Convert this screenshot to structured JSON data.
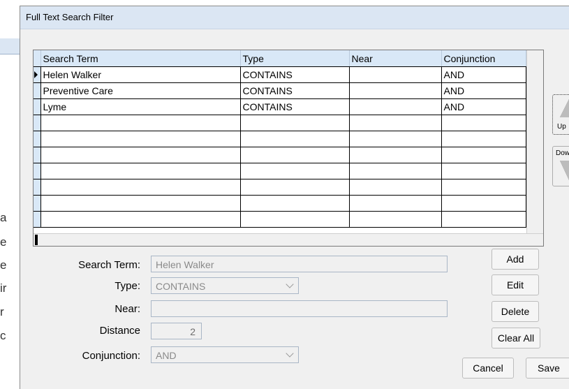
{
  "background": {
    "letters": [
      "a",
      "e",
      "e",
      "ir",
      "r",
      "c"
    ]
  },
  "dialog": {
    "title": "Full Text Search Filter"
  },
  "grid": {
    "columns": [
      "Search Term",
      "Type",
      "Near",
      "Conjunction"
    ],
    "rows": [
      {
        "term": "Helen Walker",
        "type": "CONTAINS",
        "near": "",
        "conjunction": "AND",
        "current": true
      },
      {
        "term": "Preventive Care",
        "type": "CONTAINS",
        "near": "",
        "conjunction": "AND"
      },
      {
        "term": "Lyme",
        "type": "CONTAINS",
        "near": "",
        "conjunction": "AND"
      },
      {
        "term": "",
        "type": "",
        "near": "",
        "conjunction": ""
      },
      {
        "term": "",
        "type": "",
        "near": "",
        "conjunction": ""
      },
      {
        "term": "",
        "type": "",
        "near": "",
        "conjunction": ""
      },
      {
        "term": "",
        "type": "",
        "near": "",
        "conjunction": ""
      },
      {
        "term": "",
        "type": "",
        "near": "",
        "conjunction": ""
      },
      {
        "term": "",
        "type": "",
        "near": "",
        "conjunction": ""
      },
      {
        "term": "",
        "type": "",
        "near": "",
        "conjunction": ""
      }
    ]
  },
  "side_buttons": {
    "up_label": "Up",
    "down_label": "Dow"
  },
  "form": {
    "search_term_label": "Search Term:",
    "search_term_value": "Helen Walker",
    "type_label": "Type:",
    "type_value": "CONTAINS",
    "near_label": "Near:",
    "near_value": "",
    "distance_label": "Distance",
    "distance_value": "2",
    "conjunction_label": "Conjunction:",
    "conjunction_value": "AND"
  },
  "buttons": {
    "add": "Add",
    "edit": "Edit",
    "delete": "Delete",
    "clear_all": "Clear All",
    "cancel": "Cancel",
    "save": "Save"
  },
  "colors": {
    "title_bar": "#dbe6f3",
    "header": "#d9e8f7",
    "dialog_bg": "#f0f0f0"
  }
}
